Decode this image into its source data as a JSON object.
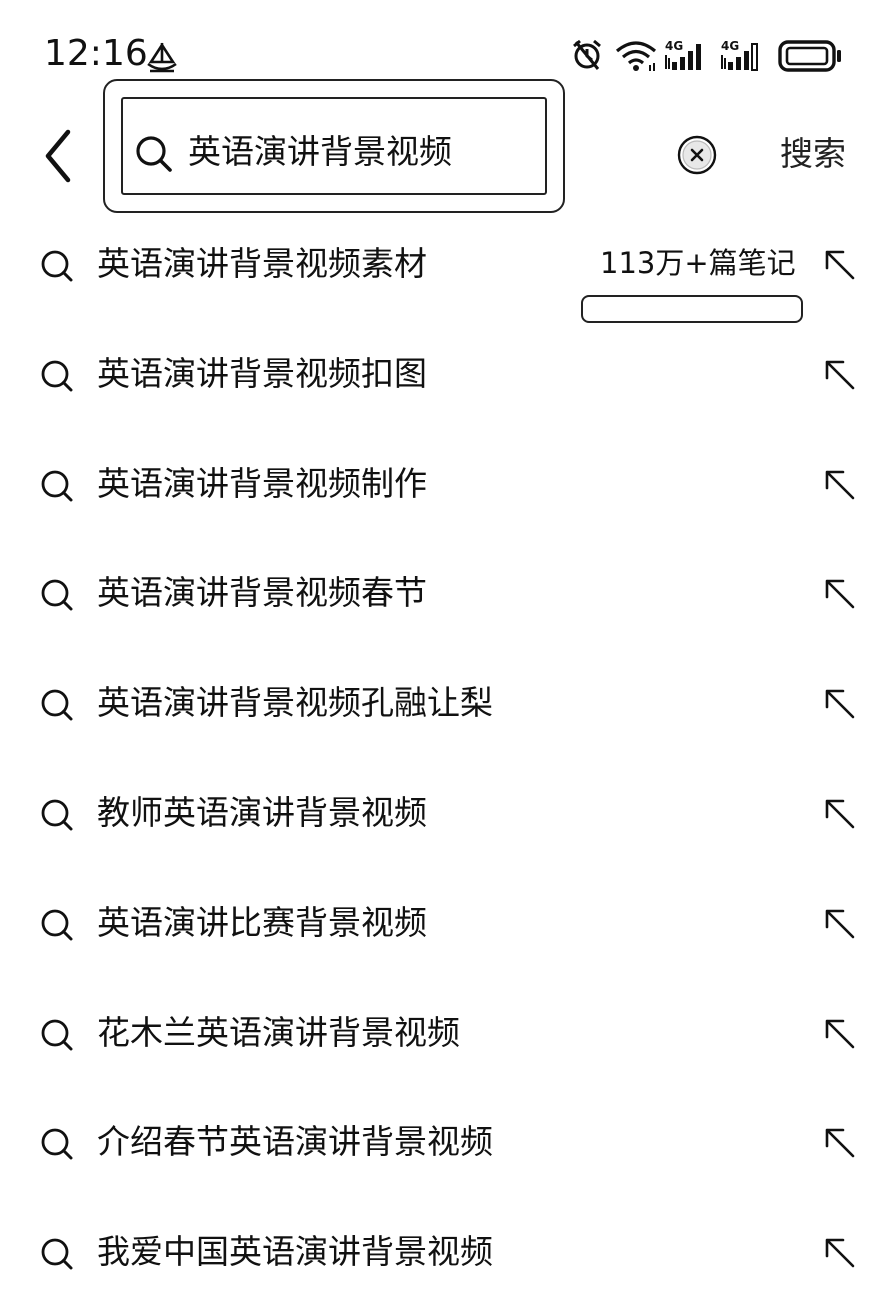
{
  "status_bar": {
    "time": "12:16",
    "network_1": "4G",
    "network_2": "4G",
    "icons": [
      "boat-notification-icon",
      "alarm-icon",
      "wifi-icon",
      "cellular-signal-icon",
      "cellular-signal-icon",
      "battery-icon"
    ]
  },
  "search": {
    "query": "英语演讲背景视频",
    "submit_label": "搜索",
    "icons": [
      "back-arrow-icon",
      "search-icon",
      "clear-icon"
    ]
  },
  "suggestions": [
    {
      "label": "英语演讲背景视频素材",
      "count": "113万+篇笔记"
    },
    {
      "label": "英语演讲背景视频扣图"
    },
    {
      "label": "英语演讲背景视频制作"
    },
    {
      "label": "英语演讲背景视频春节"
    },
    {
      "label": "英语演讲背景视频孔融让梨"
    },
    {
      "label": "教师英语演讲背景视频"
    },
    {
      "label": "英语演讲比赛背景视频"
    },
    {
      "label": "花木兰英语演讲背景视频"
    },
    {
      "label": "介绍春节英语演讲背景视频"
    },
    {
      "label": "我爱中国英语演讲背景视频"
    }
  ],
  "colors": {
    "text": "#111111",
    "background": "#ffffff",
    "border": "#222222"
  }
}
